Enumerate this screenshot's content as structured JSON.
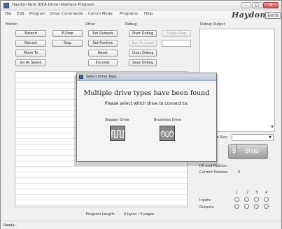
{
  "window": {
    "title": "Haydon Kerk IDEA Drive Interface Program",
    "controls": {
      "minimize": "–",
      "maximize": "□",
      "close": "×"
    }
  },
  "menu": [
    "File",
    "Edit",
    "Program",
    "Drive Commands",
    "Comm Mode",
    "Programs",
    "Help"
  ],
  "brand": {
    "name": "Haydon",
    "sub": "kerk"
  },
  "motion": {
    "label": "Motion",
    "buttons": {
      "extend": "Extend",
      "e_stop": "E-Stop",
      "retract": "Retract",
      "stop": "Stop",
      "move_to": "Move To",
      "go_at_speed": "Go At Speed"
    }
  },
  "other": {
    "label": "Other",
    "buttons": {
      "set_outputs": "Set Outputs",
      "set_position": "Set Position",
      "reset": "Reset",
      "encoder": "Encoder"
    }
  },
  "debug": {
    "label": "Debug",
    "buttons": {
      "start_debug": "Start Debug",
      "single_step": "Single Step",
      "run_to_label": "Run To Label",
      "clear_debug": "Clear Debug",
      "save_debug": "Save Debug"
    },
    "output_label": "Debug Output"
  },
  "dialog": {
    "title": "Select Drive Type",
    "heading": "Multiple drive types have been found",
    "subheading": "Please select which drive to connect to:",
    "options": {
      "stepper": "Stepper Drive",
      "brushless": "Brushless Drive"
    }
  },
  "run": {
    "label": "Program to Run:",
    "start": "Start",
    "stop": "Stop"
  },
  "io": {
    "title": "I/O and Position",
    "current_position_label": "Current Position:",
    "current_position_value": "0",
    "channels": [
      "1",
      "2",
      "3",
      "4"
    ],
    "inputs_label": "Inputs:",
    "outputs_label": "Outputs:"
  },
  "program_length": {
    "label": "Program Length:",
    "value": "0 bytes / 0 pages"
  },
  "status": "Ready..."
}
